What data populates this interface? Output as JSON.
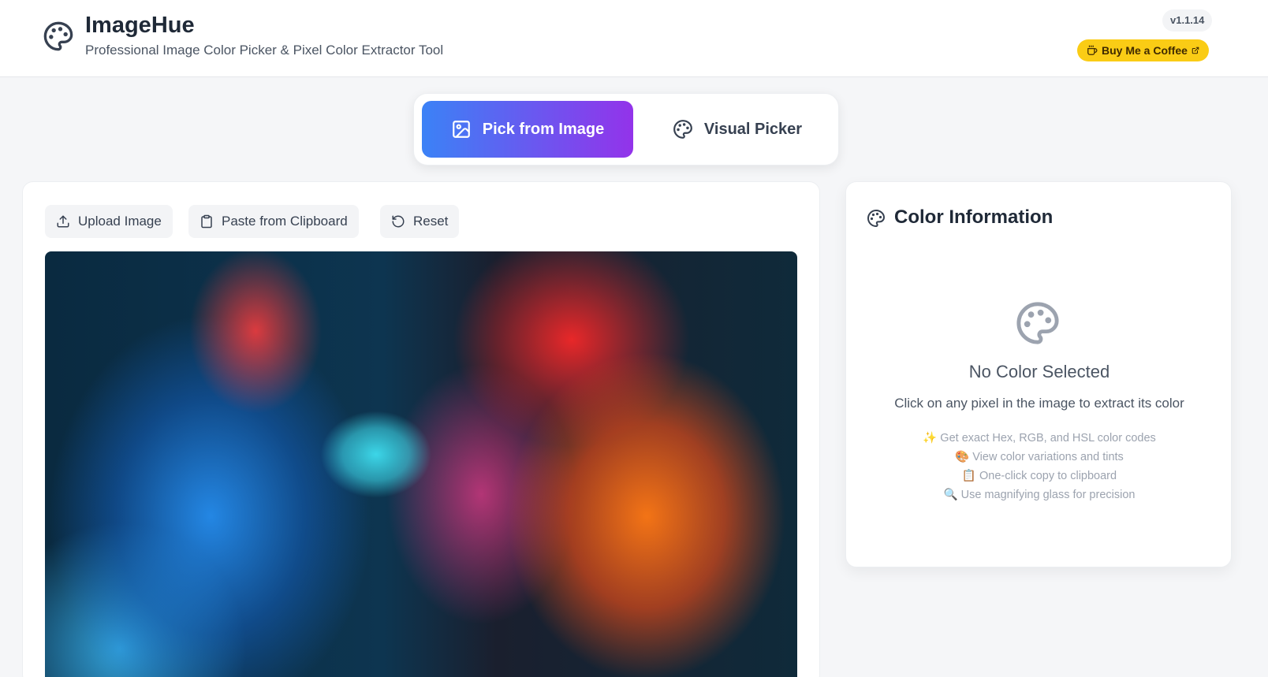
{
  "header": {
    "title": "ImageHue",
    "subtitle": "Professional Image Color Picker & Pixel Color Extractor Tool",
    "version": "v1.1.14",
    "coffee_label": "Buy Me a Coffee"
  },
  "mode_tabs": {
    "pick_from_image": "Pick from Image",
    "visual_picker": "Visual Picker",
    "active": "pick_from_image"
  },
  "toolbar": {
    "upload_label": "Upload Image",
    "paste_label": "Paste from Clipboard",
    "reset_label": "Reset"
  },
  "color_info": {
    "title": "Color Information",
    "empty_title": "No Color Selected",
    "empty_desc": "Click on any pixel in the image to extract its color",
    "tips": [
      "✨ Get exact Hex, RGB, and HSL color codes",
      "🎨 View color variations and tints",
      "📋 One-click copy to clipboard",
      "🔍 Use magnifying glass for precision"
    ]
  },
  "colors": {
    "accent_gradient_start": "#3b82f6",
    "accent_gradient_end": "#9333ea",
    "coffee_yellow": "#facc15",
    "background": "#f5f6f8"
  }
}
